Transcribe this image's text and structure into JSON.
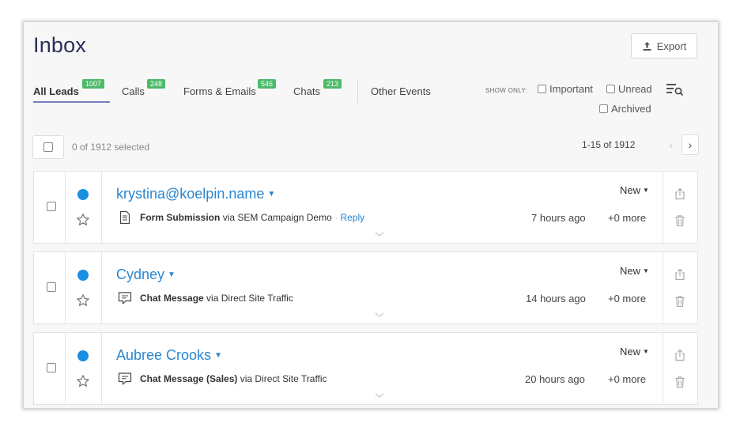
{
  "header": {
    "title": "Inbox",
    "export_label": "Export"
  },
  "tabs": [
    {
      "label": "All Leads",
      "count": "1007"
    },
    {
      "label": "Calls",
      "count": "248"
    },
    {
      "label": "Forms & Emails",
      "count": "546"
    },
    {
      "label": "Chats",
      "count": "213"
    },
    {
      "label": "Other Events"
    }
  ],
  "filters": {
    "show_only_label": "SHOW ONLY:",
    "important_label": "Important",
    "unread_label": "Unread",
    "archived_label": "Archived"
  },
  "selection": {
    "text": "0 of 1912 selected"
  },
  "pagination": {
    "text": "1-15 of 1912"
  },
  "leads": [
    {
      "name": "krystina@koelpin.name",
      "type_icon": "form-icon",
      "event": "Form Submission",
      "source_prefix": "via",
      "source": "SEM Campaign Demo",
      "separator": "·",
      "reply": "Reply",
      "time": "7 hours ago",
      "more": "+0 more",
      "status": "New"
    },
    {
      "name": "Cydney",
      "type_icon": "chat-icon",
      "event": "Chat Message",
      "source_prefix": "via",
      "source": "Direct Site Traffic",
      "time": "14 hours ago",
      "more": "+0 more",
      "status": "New"
    },
    {
      "name": "Aubree Crooks",
      "type_icon": "chat-icon",
      "event": "Chat Message (Sales)",
      "source_prefix": "via",
      "source": "Direct Site Traffic",
      "time": "20 hours ago",
      "more": "+0 more",
      "status": "New"
    }
  ],
  "colors": {
    "accent": "#2a86d0",
    "unread_dot": "#1a8fe0",
    "badge": "#4cba6a",
    "title": "#2c2f5a"
  }
}
